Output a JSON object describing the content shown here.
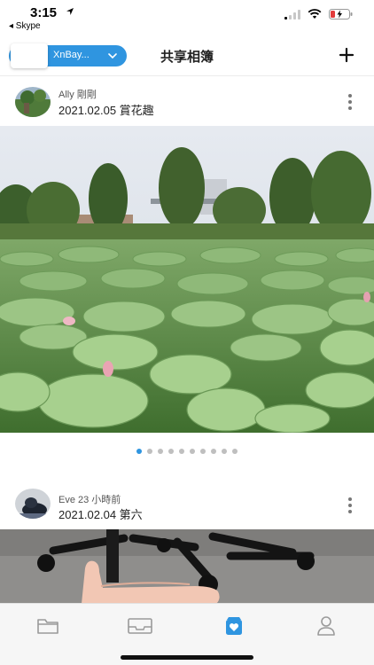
{
  "status_bar": {
    "time": "3:15",
    "back_app": "◂ Skype"
  },
  "header": {
    "site_selector_label": "XnBay...",
    "title": "共享相簿"
  },
  "posts": [
    {
      "author": "Ally  剛剛",
      "title": "2021.02.05 賞花趣"
    },
    {
      "author": "Eve  23 小時前",
      "title": "2021.02.04 第六"
    }
  ],
  "carousel": {
    "total_pages": 10,
    "active_page": 1
  },
  "tabbar": {
    "active_tab": "album",
    "active_color": "#2f95e0",
    "inactive_color": "#9a9a9a"
  },
  "colors": {
    "accent": "#2f95e0"
  }
}
